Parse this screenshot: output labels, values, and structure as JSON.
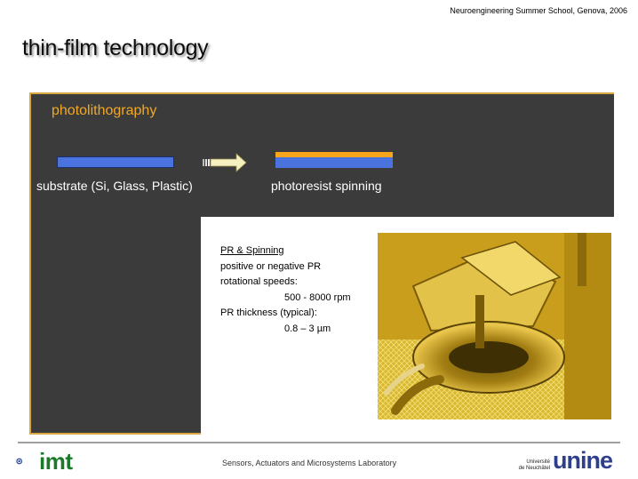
{
  "header": {
    "note": "Neuroengineering Summer School, Genova, 2006"
  },
  "slide": {
    "title": "thin-film technology"
  },
  "panel": {
    "heading": "photolithography",
    "steps": [
      {
        "label": "substrate (Si, Glass, Plastic)"
      },
      {
        "label": "photoresist spinning"
      }
    ]
  },
  "info": {
    "title": "PR & Spinning",
    "lines": [
      "positive or negative PR",
      "rotational speeds:",
      "500  - 8000 rpm",
      "PR thickness (typical):",
      "0.8 – 3 µm"
    ]
  },
  "footer": {
    "lab": "Sensors, Actuators and Microsystems Laboratory",
    "imt_logo": "imt",
    "unine_small_1": "Université",
    "unine_small_2": "de Neuchâtel",
    "unine_logo": "unine"
  },
  "colors": {
    "panel": "#3b3b3b",
    "accent": "#f3a824",
    "substrate": "#4a73e0",
    "photoresist": "#f6a51c"
  }
}
